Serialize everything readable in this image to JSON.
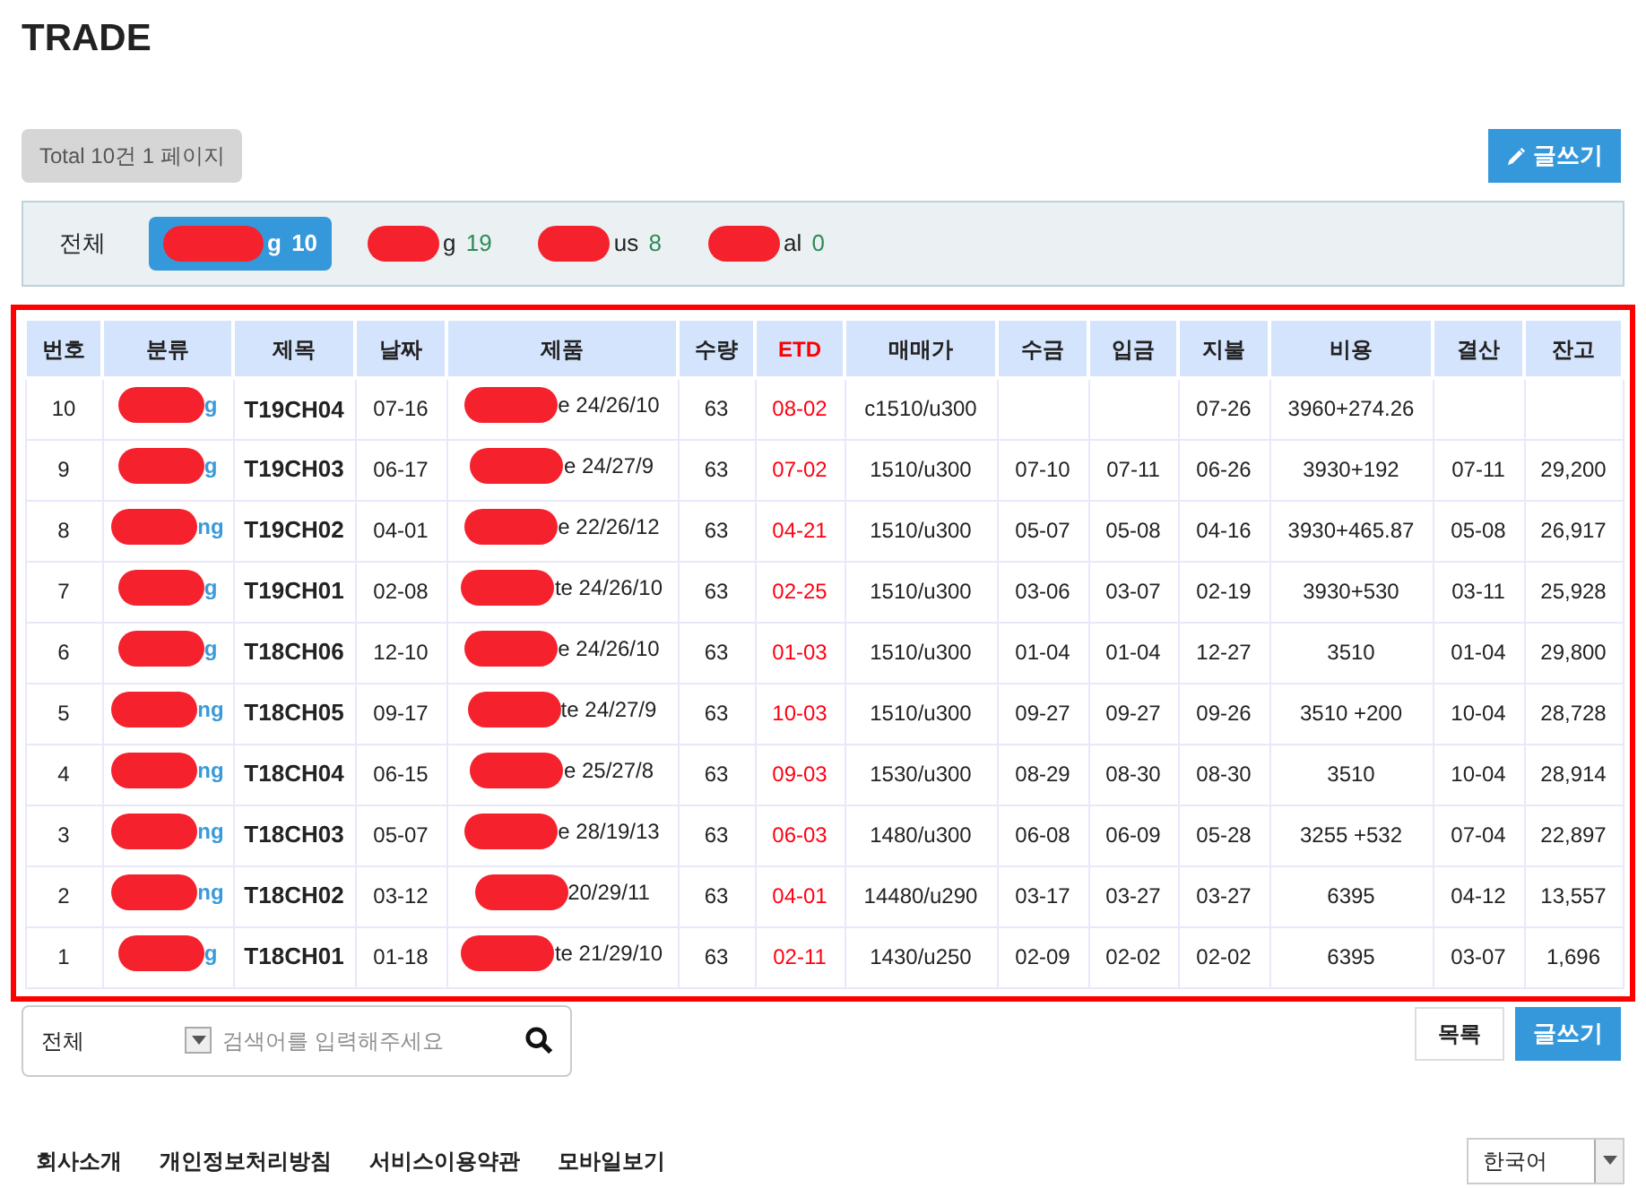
{
  "page_title": "TRADE",
  "total_badge": "Total 10건 1 페이지",
  "write_button": "글쓰기",
  "filter_bar": {
    "all_label": "전체",
    "filters": [
      {
        "label": "g",
        "count": "10",
        "selected": true
      },
      {
        "label": "g",
        "count": "19",
        "selected": false
      },
      {
        "label": "us",
        "count": "8",
        "selected": false
      },
      {
        "label": "al",
        "count": "0",
        "selected": false
      }
    ]
  },
  "table": {
    "columns": [
      "번호",
      "분류",
      "제목",
      "날짜",
      "제품",
      "수량",
      "ETD",
      "매매가",
      "수금",
      "입금",
      "지불",
      "비용",
      "결산",
      "잔고"
    ],
    "rows": [
      [
        "10",
        "g",
        "T19CH04",
        "07-16",
        "e 24/26/10",
        "63",
        "08-02",
        "c1510/u300",
        "",
        "",
        "07-26",
        "3960+274.26",
        "",
        ""
      ],
      [
        "9",
        "g",
        "T19CH03",
        "06-17",
        "e 24/27/9",
        "63",
        "07-02",
        "1510/u300",
        "07-10",
        "07-11",
        "06-26",
        "3930+192",
        "07-11",
        "29,200"
      ],
      [
        "8",
        "ng",
        "T19CH02",
        "04-01",
        "e 22/26/12",
        "63",
        "04-21",
        "1510/u300",
        "05-07",
        "05-08",
        "04-16",
        "3930+465.87",
        "05-08",
        "26,917"
      ],
      [
        "7",
        "g",
        "T19CH01",
        "02-08",
        "te 24/26/10",
        "63",
        "02-25",
        "1510/u300",
        "03-06",
        "03-07",
        "02-19",
        "3930+530",
        "03-11",
        "25,928"
      ],
      [
        "6",
        "g",
        "T18CH06",
        "12-10",
        "e 24/26/10",
        "63",
        "01-03",
        "1510/u300",
        "01-04",
        "01-04",
        "12-27",
        "3510",
        "01-04",
        "29,800"
      ],
      [
        "5",
        "ng",
        "T18CH05",
        "09-17",
        "te 24/27/9",
        "63",
        "10-03",
        "1510/u300",
        "09-27",
        "09-27",
        "09-26",
        "3510 +200",
        "10-04",
        "28,728"
      ],
      [
        "4",
        "ng",
        "T18CH04",
        "06-15",
        "e 25/27/8",
        "63",
        "09-03",
        "1530/u300",
        "08-29",
        "08-30",
        "08-30",
        "3510",
        "10-04",
        "28,914"
      ],
      [
        "3",
        "ng",
        "T18CH03",
        "05-07",
        "e 28/19/13",
        "63",
        "06-03",
        "1480/u300",
        "06-08",
        "06-09",
        "05-28",
        "3255 +532",
        "07-04",
        "22,897"
      ],
      [
        "2",
        "ng",
        "T18CH02",
        "03-12",
        "20/29/11",
        "63",
        "04-01",
        "14480/u290",
        "03-17",
        "03-27",
        "03-27",
        "6395",
        "04-12",
        "13,557"
      ],
      [
        "1",
        "g",
        "T18CH01",
        "01-18",
        "te 21/29/10",
        "63",
        "02-11",
        "1430/u250",
        "02-09",
        "02-02",
        "02-02",
        "6395",
        "03-07",
        "1,696"
      ]
    ]
  },
  "search": {
    "scope": "전체",
    "placeholder": "검색어를 입력해주세요"
  },
  "list_button": "목록",
  "bottom_write_button": "글쓰기",
  "footer_links": [
    "회사소개",
    "개인정보처리방침",
    "서비스이용약관",
    "모바일보기"
  ],
  "language_select": "한국어"
}
